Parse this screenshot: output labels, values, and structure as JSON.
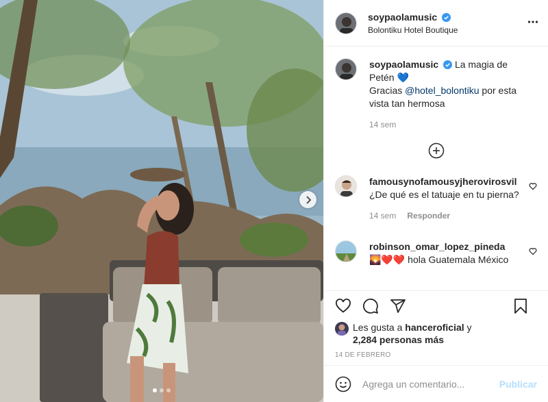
{
  "post": {
    "author": "soypaolamusic",
    "location": "Bolontiku Hotel Boutique",
    "caption_part1": "La magia de Petén 💙",
    "caption_part2": "Gracias ",
    "caption_mention": "@hotel_bolontiku",
    "caption_part3": " por esta vista tan hermosa",
    "caption_time": "14 sem"
  },
  "comments": [
    {
      "username": "famousynofamousyjherovirosvil",
      "text": "¿De qué es el tatuaje en tu pierna?",
      "time": "14 sem",
      "reply_label": "Responder"
    },
    {
      "username": "robinson_omar_lopez_pineda",
      "text": "🌄❤️❤️ hola Guatemala México"
    }
  ],
  "likes": {
    "prefix": "Les gusta a ",
    "liker": "hanceroficial",
    "connector": " y",
    "count_text": "2,284 personas más"
  },
  "date": "14 DE FEBRERO",
  "add_comment": {
    "placeholder": "Agrega un comentario...",
    "publish_label": "Publicar"
  },
  "carousel": {
    "total": 3,
    "active": 1
  },
  "colors": {
    "verified": "#3897f0",
    "link": "#00376b",
    "publish": "#b2dffc",
    "muted": "#8e8e8e"
  },
  "icons": [
    "more-icon",
    "verified-icon",
    "heart-icon",
    "comment-icon",
    "share-icon",
    "save-icon",
    "plus-circle-icon",
    "emoji-icon",
    "chevron-right-icon"
  ]
}
